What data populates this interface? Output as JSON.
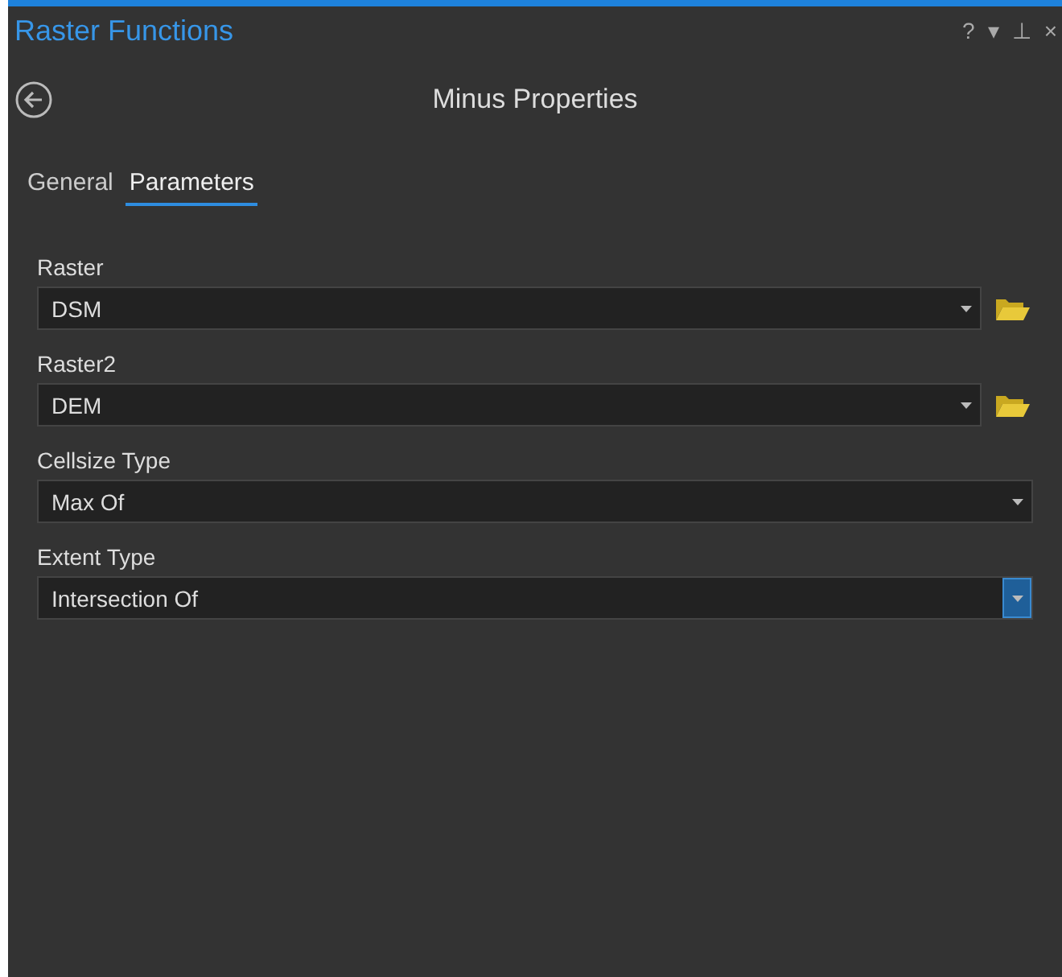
{
  "window": {
    "title": "Raster Functions",
    "controls": [
      "?",
      "▾",
      "⊥",
      "×"
    ]
  },
  "header": {
    "title": "Minus Properties"
  },
  "tabs": [
    {
      "label": "General",
      "selected": false
    },
    {
      "label": "Parameters",
      "selected": true
    }
  ],
  "parameters": [
    {
      "label": "Raster",
      "value": "DSM",
      "kind": "raster",
      "focused": false
    },
    {
      "label": "Raster2",
      "value": "DEM",
      "kind": "raster",
      "focused": false
    },
    {
      "label": "Cellsize Type",
      "value": "Max Of",
      "kind": "choice",
      "focused": false
    },
    {
      "label": "Extent Type",
      "value": "Intersection Of",
      "kind": "choice",
      "focused": true
    }
  ]
}
